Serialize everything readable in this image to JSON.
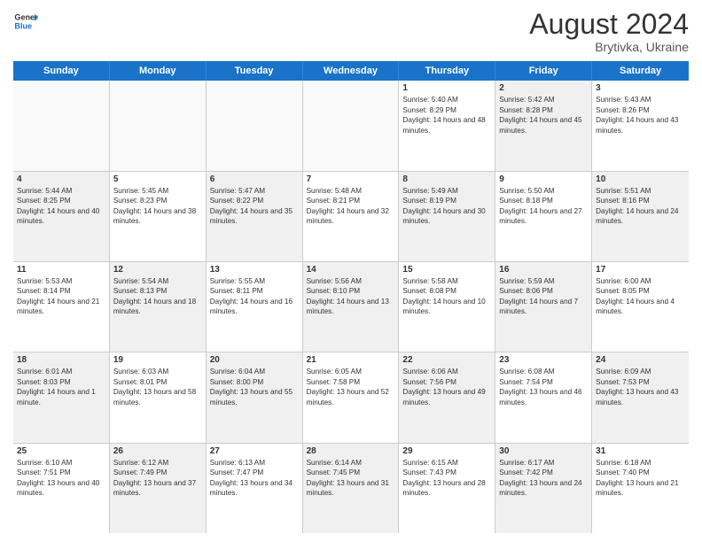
{
  "logo": {
    "line1": "General",
    "line2": "Blue"
  },
  "title": "August 2024",
  "subtitle": "Brytivka, Ukraine",
  "days": [
    "Sunday",
    "Monday",
    "Tuesday",
    "Wednesday",
    "Thursday",
    "Friday",
    "Saturday"
  ],
  "weeks": [
    [
      {
        "day": "",
        "sunrise": "",
        "sunset": "",
        "daylight": "",
        "shaded": false,
        "empty": true
      },
      {
        "day": "",
        "sunrise": "",
        "sunset": "",
        "daylight": "",
        "shaded": false,
        "empty": true
      },
      {
        "day": "",
        "sunrise": "",
        "sunset": "",
        "daylight": "",
        "shaded": false,
        "empty": true
      },
      {
        "day": "",
        "sunrise": "",
        "sunset": "",
        "daylight": "",
        "shaded": false,
        "empty": true
      },
      {
        "day": "1",
        "sunrise": "Sunrise: 5:40 AM",
        "sunset": "Sunset: 8:29 PM",
        "daylight": "Daylight: 14 hours and 48 minutes.",
        "shaded": false,
        "empty": false
      },
      {
        "day": "2",
        "sunrise": "Sunrise: 5:42 AM",
        "sunset": "Sunset: 8:28 PM",
        "daylight": "Daylight: 14 hours and 45 minutes.",
        "shaded": true,
        "empty": false
      },
      {
        "day": "3",
        "sunrise": "Sunrise: 5:43 AM",
        "sunset": "Sunset: 8:26 PM",
        "daylight": "Daylight: 14 hours and 43 minutes.",
        "shaded": false,
        "empty": false
      }
    ],
    [
      {
        "day": "4",
        "sunrise": "Sunrise: 5:44 AM",
        "sunset": "Sunset: 8:25 PM",
        "daylight": "Daylight: 14 hours and 40 minutes.",
        "shaded": true,
        "empty": false
      },
      {
        "day": "5",
        "sunrise": "Sunrise: 5:45 AM",
        "sunset": "Sunset: 8:23 PM",
        "daylight": "Daylight: 14 hours and 38 minutes.",
        "shaded": false,
        "empty": false
      },
      {
        "day": "6",
        "sunrise": "Sunrise: 5:47 AM",
        "sunset": "Sunset: 8:22 PM",
        "daylight": "Daylight: 14 hours and 35 minutes.",
        "shaded": true,
        "empty": false
      },
      {
        "day": "7",
        "sunrise": "Sunrise: 5:48 AM",
        "sunset": "Sunset: 8:21 PM",
        "daylight": "Daylight: 14 hours and 32 minutes.",
        "shaded": false,
        "empty": false
      },
      {
        "day": "8",
        "sunrise": "Sunrise: 5:49 AM",
        "sunset": "Sunset: 8:19 PM",
        "daylight": "Daylight: 14 hours and 30 minutes.",
        "shaded": true,
        "empty": false
      },
      {
        "day": "9",
        "sunrise": "Sunrise: 5:50 AM",
        "sunset": "Sunset: 8:18 PM",
        "daylight": "Daylight: 14 hours and 27 minutes.",
        "shaded": false,
        "empty": false
      },
      {
        "day": "10",
        "sunrise": "Sunrise: 5:51 AM",
        "sunset": "Sunset: 8:16 PM",
        "daylight": "Daylight: 14 hours and 24 minutes.",
        "shaded": true,
        "empty": false
      }
    ],
    [
      {
        "day": "11",
        "sunrise": "Sunrise: 5:53 AM",
        "sunset": "Sunset: 8:14 PM",
        "daylight": "Daylight: 14 hours and 21 minutes.",
        "shaded": false,
        "empty": false
      },
      {
        "day": "12",
        "sunrise": "Sunrise: 5:54 AM",
        "sunset": "Sunset: 8:13 PM",
        "daylight": "Daylight: 14 hours and 18 minutes.",
        "shaded": true,
        "empty": false
      },
      {
        "day": "13",
        "sunrise": "Sunrise: 5:55 AM",
        "sunset": "Sunset: 8:11 PM",
        "daylight": "Daylight: 14 hours and 16 minutes.",
        "shaded": false,
        "empty": false
      },
      {
        "day": "14",
        "sunrise": "Sunrise: 5:56 AM",
        "sunset": "Sunset: 8:10 PM",
        "daylight": "Daylight: 14 hours and 13 minutes.",
        "shaded": true,
        "empty": false
      },
      {
        "day": "15",
        "sunrise": "Sunrise: 5:58 AM",
        "sunset": "Sunset: 8:08 PM",
        "daylight": "Daylight: 14 hours and 10 minutes.",
        "shaded": false,
        "empty": false
      },
      {
        "day": "16",
        "sunrise": "Sunrise: 5:59 AM",
        "sunset": "Sunset: 8:06 PM",
        "daylight": "Daylight: 14 hours and 7 minutes.",
        "shaded": true,
        "empty": false
      },
      {
        "day": "17",
        "sunrise": "Sunrise: 6:00 AM",
        "sunset": "Sunset: 8:05 PM",
        "daylight": "Daylight: 14 hours and 4 minutes.",
        "shaded": false,
        "empty": false
      }
    ],
    [
      {
        "day": "18",
        "sunrise": "Sunrise: 6:01 AM",
        "sunset": "Sunset: 8:03 PM",
        "daylight": "Daylight: 14 hours and 1 minute.",
        "shaded": true,
        "empty": false
      },
      {
        "day": "19",
        "sunrise": "Sunrise: 6:03 AM",
        "sunset": "Sunset: 8:01 PM",
        "daylight": "Daylight: 13 hours and 58 minutes.",
        "shaded": false,
        "empty": false
      },
      {
        "day": "20",
        "sunrise": "Sunrise: 6:04 AM",
        "sunset": "Sunset: 8:00 PM",
        "daylight": "Daylight: 13 hours and 55 minutes.",
        "shaded": true,
        "empty": false
      },
      {
        "day": "21",
        "sunrise": "Sunrise: 6:05 AM",
        "sunset": "Sunset: 7:58 PM",
        "daylight": "Daylight: 13 hours and 52 minutes.",
        "shaded": false,
        "empty": false
      },
      {
        "day": "22",
        "sunrise": "Sunrise: 6:06 AM",
        "sunset": "Sunset: 7:56 PM",
        "daylight": "Daylight: 13 hours and 49 minutes.",
        "shaded": true,
        "empty": false
      },
      {
        "day": "23",
        "sunrise": "Sunrise: 6:08 AM",
        "sunset": "Sunset: 7:54 PM",
        "daylight": "Daylight: 13 hours and 46 minutes.",
        "shaded": false,
        "empty": false
      },
      {
        "day": "24",
        "sunrise": "Sunrise: 6:09 AM",
        "sunset": "Sunset: 7:53 PM",
        "daylight": "Daylight: 13 hours and 43 minutes.",
        "shaded": true,
        "empty": false
      }
    ],
    [
      {
        "day": "25",
        "sunrise": "Sunrise: 6:10 AM",
        "sunset": "Sunset: 7:51 PM",
        "daylight": "Daylight: 13 hours and 40 minutes.",
        "shaded": false,
        "empty": false
      },
      {
        "day": "26",
        "sunrise": "Sunrise: 6:12 AM",
        "sunset": "Sunset: 7:49 PM",
        "daylight": "Daylight: 13 hours and 37 minutes.",
        "shaded": true,
        "empty": false
      },
      {
        "day": "27",
        "sunrise": "Sunrise: 6:13 AM",
        "sunset": "Sunset: 7:47 PM",
        "daylight": "Daylight: 13 hours and 34 minutes.",
        "shaded": false,
        "empty": false
      },
      {
        "day": "28",
        "sunrise": "Sunrise: 6:14 AM",
        "sunset": "Sunset: 7:45 PM",
        "daylight": "Daylight: 13 hours and 31 minutes.",
        "shaded": true,
        "empty": false
      },
      {
        "day": "29",
        "sunrise": "Sunrise: 6:15 AM",
        "sunset": "Sunset: 7:43 PM",
        "daylight": "Daylight: 13 hours and 28 minutes.",
        "shaded": false,
        "empty": false
      },
      {
        "day": "30",
        "sunrise": "Sunrise: 6:17 AM",
        "sunset": "Sunset: 7:42 PM",
        "daylight": "Daylight: 13 hours and 24 minutes.",
        "shaded": true,
        "empty": false
      },
      {
        "day": "31",
        "sunrise": "Sunrise: 6:18 AM",
        "sunset": "Sunset: 7:40 PM",
        "daylight": "Daylight: 13 hours and 21 minutes.",
        "shaded": false,
        "empty": false
      }
    ]
  ]
}
